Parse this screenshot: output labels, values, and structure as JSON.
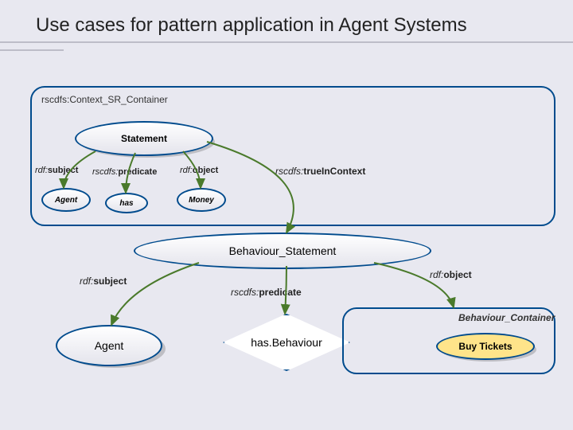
{
  "title": "Use cases for pattern application in Agent Systems",
  "context_container": {
    "label": "rscdfs:Context_SR_Container"
  },
  "behaviour_container": {
    "label": "Behaviour_Container"
  },
  "nodes": {
    "statement": {
      "label": "Statement"
    },
    "behaviour_statement": {
      "label": "Behaviour_Statement"
    },
    "agent_small": {
      "label": "Agent"
    },
    "has_small": {
      "label": "has"
    },
    "money": {
      "label": "Money"
    },
    "agent_big": {
      "label": "Agent"
    },
    "has_behaviour": {
      "label": "has.Behaviour"
    },
    "buy_tickets": {
      "label": "Buy Tickets"
    }
  },
  "edges": {
    "rdf_subject_small": {
      "prefix": "rdf:",
      "local": "subject"
    },
    "rscdfs_predicate_small": {
      "prefix": "rscdfs:",
      "local": "predicate"
    },
    "rdf_object_small": {
      "prefix": "rdf:",
      "local": "object"
    },
    "rscdfs_trueincontext": {
      "prefix": "rscdfs:",
      "local": "trueInContext"
    },
    "rdf_subject_big": {
      "prefix": "rdf:",
      "local": "subject"
    },
    "rscdfs_predicate_big": {
      "prefix": "rscdfs:",
      "local": "predicate"
    },
    "rdf_object_big": {
      "prefix": "rdf:",
      "local": "object"
    }
  }
}
